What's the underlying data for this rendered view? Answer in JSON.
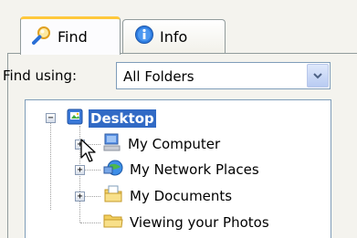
{
  "tabs": [
    {
      "label": "Find",
      "icon": "find-magnifier-icon",
      "active": true
    },
    {
      "label": "Info",
      "icon": "info-icon",
      "active": false
    }
  ],
  "find_using": {
    "label": "Find using:",
    "value": "All Folders"
  },
  "tree": {
    "root": {
      "label": "Desktop",
      "icon": "desktop-icon",
      "selected": true
    },
    "items": [
      {
        "label": "My Computer",
        "icon": "my-computer-icon",
        "expandable": true
      },
      {
        "label": "My Network Places",
        "icon": "network-places-icon",
        "expandable": true
      },
      {
        "label": "My Documents",
        "icon": "my-documents-icon",
        "expandable": true
      },
      {
        "label": "Viewing your Photos",
        "icon": "folder-icon",
        "expandable": false
      }
    ]
  },
  "colors": {
    "selection": "#316ac5",
    "tab_highlight": "#ffc83c",
    "border": "#7f9db9"
  }
}
